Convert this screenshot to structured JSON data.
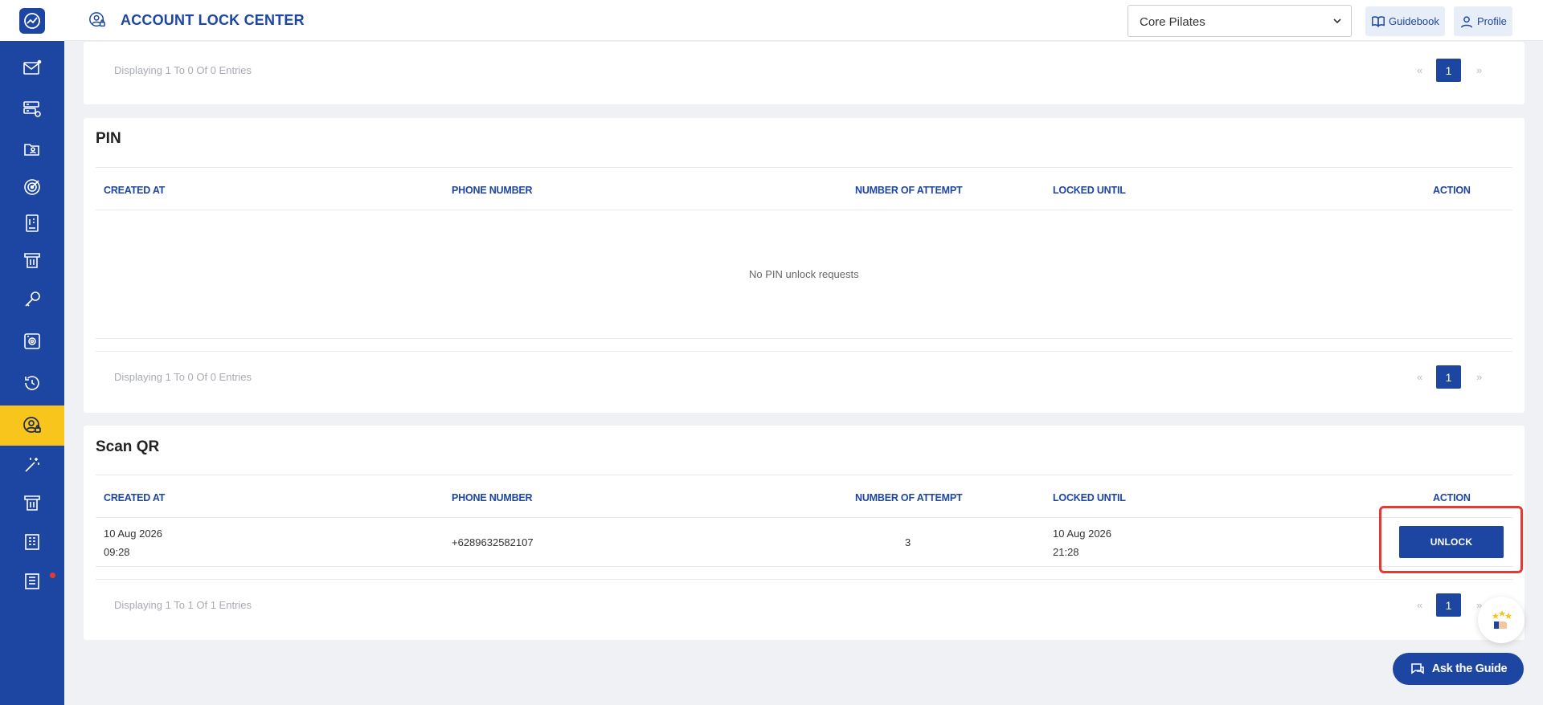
{
  "header": {
    "title": "ACCOUNT LOCK CENTER",
    "studio_select": "Core Pilates",
    "guidebook_label": "Guidebook",
    "profile_label": "Profile"
  },
  "sidebar": {
    "items": [
      {
        "icon": "mail-icon"
      },
      {
        "icon": "server-settings-icon"
      },
      {
        "icon": "folder-user-icon"
      },
      {
        "icon": "target-icon"
      },
      {
        "icon": "ledger-icon"
      },
      {
        "icon": "ticket-icon"
      },
      {
        "icon": "key-icon"
      },
      {
        "icon": "camera-settings-icon"
      },
      {
        "icon": "history-icon"
      },
      {
        "icon": "user-lock-icon",
        "active": true
      },
      {
        "icon": "magic-wand-icon"
      },
      {
        "icon": "ticket-alt-icon"
      },
      {
        "icon": "report-icon"
      },
      {
        "icon": "receipt-icon",
        "notification": true
      }
    ]
  },
  "top_section": {
    "pagination_info": "Displaying 1 To 0 Of 0 Entries",
    "page": "1"
  },
  "pin": {
    "title": "PIN",
    "columns": [
      "CREATED AT",
      "PHONE NUMBER",
      "NUMBER OF ATTEMPT",
      "LOCKED UNTIL",
      "ACTION"
    ],
    "empty_text": "No PIN unlock requests",
    "pagination_info": "Displaying 1 To 0 Of 0 Entries",
    "page": "1"
  },
  "scan_qr": {
    "title": "Scan QR",
    "columns": [
      "CREATED AT",
      "PHONE NUMBER",
      "NUMBER OF ATTEMPT",
      "LOCKED UNTIL",
      "ACTION"
    ],
    "rows": [
      {
        "created_date": "10 Aug 2026",
        "created_time": "09:28",
        "phone": "+6289632582107",
        "attempts": "3",
        "locked_date": "10 Aug 2026",
        "locked_time": "21:28",
        "action_label": "UNLOCK"
      }
    ],
    "pagination_info": "Displaying 1 To 1 Of 1 Entries",
    "page": "1"
  },
  "pagination": {
    "prev": "«",
    "next": "»"
  },
  "ask_guide_label": "Ask the Guide",
  "colors": {
    "primary": "#1d46a3",
    "active": "#f8c51c",
    "highlight": "#e53935"
  }
}
